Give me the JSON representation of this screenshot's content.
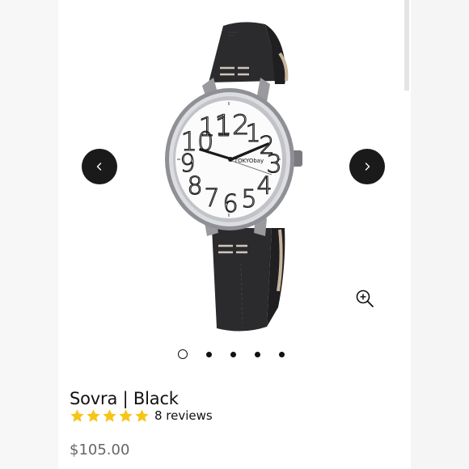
{
  "product": {
    "title": "Sovra | Black",
    "rating_value": 5,
    "rating_max": 5,
    "reviews_label": "8 reviews",
    "price": "$105.00"
  },
  "watch_dial": {
    "brand": "TOKYObay",
    "numerals": [
      "12",
      "1",
      "2",
      "3",
      "4",
      "5",
      "6",
      "7",
      "8",
      "9",
      "10",
      "11"
    ]
  },
  "carousel": {
    "slide_count": 5,
    "active_slide": 1
  },
  "icons": {
    "prev": "chevron-left-icon",
    "next": "chevron-right-icon",
    "zoom": "zoom-in-icon",
    "star": "star-icon"
  },
  "colors": {
    "star": "#f5c518",
    "nav_button": "#1a1a1a",
    "strap": "#2b2b2d",
    "price": "#666666"
  }
}
